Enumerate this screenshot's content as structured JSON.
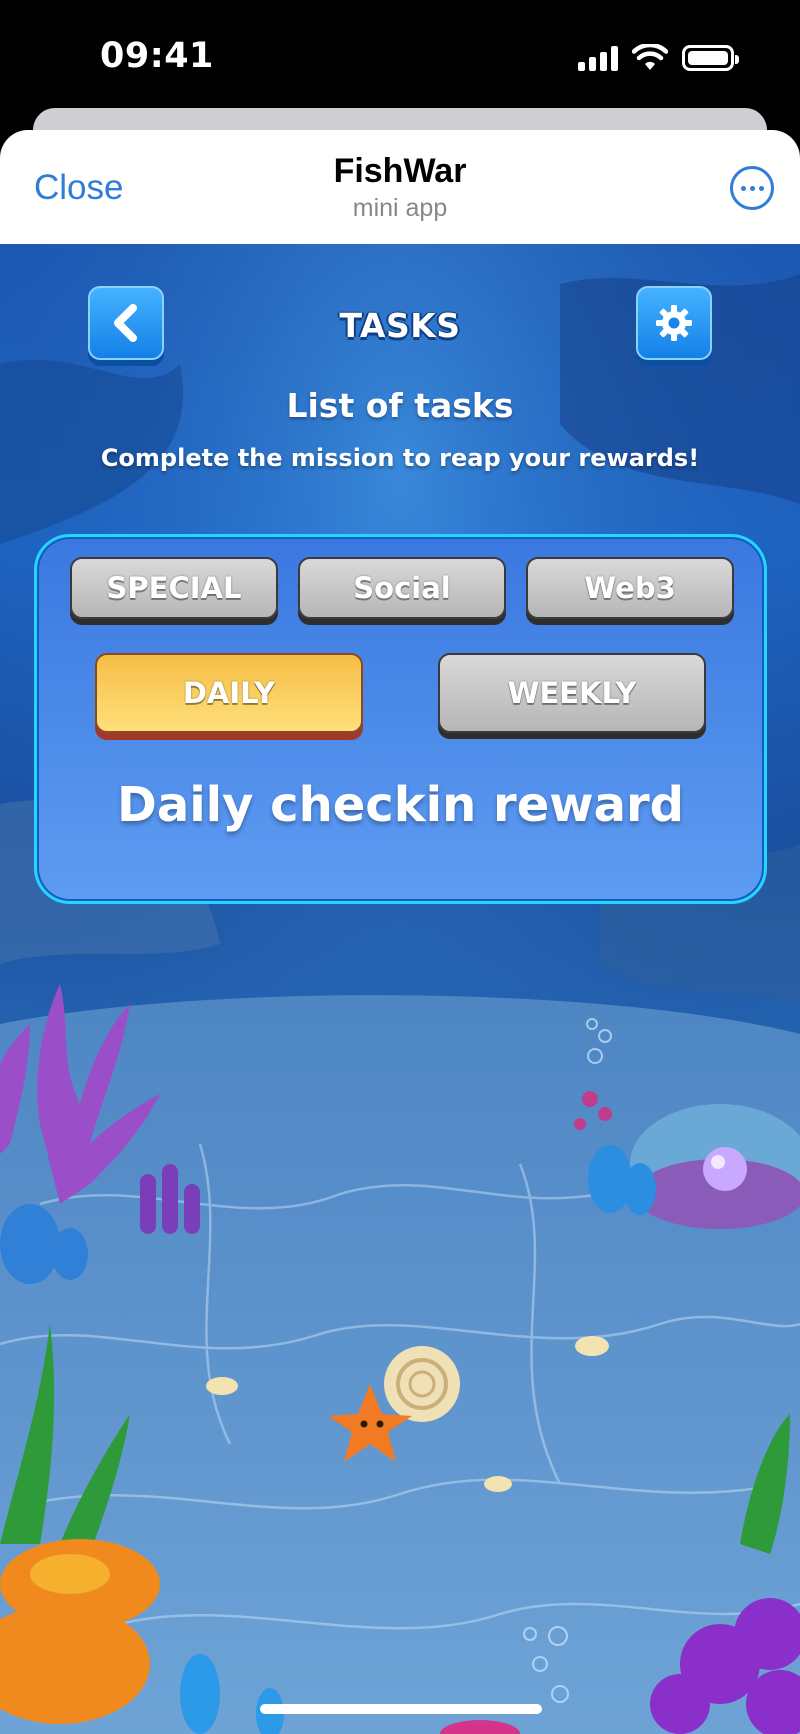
{
  "status_bar": {
    "time": "09:41",
    "icons": [
      "signal-icon",
      "wifi-icon",
      "battery-icon"
    ]
  },
  "header": {
    "close_label": "Close",
    "title": "FishWar",
    "subtitle": "mini app",
    "more_icon": "more-icon",
    "accent_color": "#2f7dd6"
  },
  "game": {
    "back_icon": "chevron-left-icon",
    "settings_icon": "gear-icon",
    "page_title": "TASKS",
    "list_heading": "List of tasks",
    "list_subtitle": "Complete the mission to reap your rewards!",
    "category_tabs": [
      {
        "label": "SPECIAL",
        "selected": false
      },
      {
        "label": "Social",
        "selected": false
      },
      {
        "label": "Web3",
        "selected": false
      }
    ],
    "period_tabs": [
      {
        "label": "DAILY",
        "selected": true
      },
      {
        "label": "WEEKLY",
        "selected": false
      }
    ],
    "section_title": "Daily checkin reward",
    "colors": {
      "panel": "#4a88e8",
      "panel_border": "#25d4ff",
      "active_tab": "#f7c85a",
      "inactive_tab": "#c4c4c4"
    }
  }
}
